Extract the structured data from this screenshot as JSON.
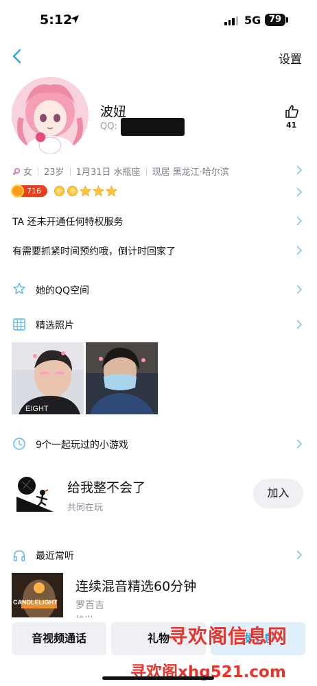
{
  "status_bar": {
    "time": "5:12",
    "network": "5G",
    "battery": "79"
  },
  "nav": {
    "settings_label": "设置"
  },
  "profile": {
    "name": "波妞",
    "qq_label": "QQ:",
    "likes": "41"
  },
  "info": {
    "gender": "女",
    "age": "23岁",
    "birthday": "1月31日 水瓶座",
    "location": "现居 黑龙江·哈尔滨",
    "level": "716"
  },
  "vip": {
    "text": "TA 还未开通任何特权服务"
  },
  "signature": {
    "text": "有需要抓紧时间预约哦，倒计时回家了"
  },
  "qzone": {
    "label": "她的QQ空间"
  },
  "photos": {
    "label": "精选照片"
  },
  "games": {
    "label": "9个一起玩过的小游戏"
  },
  "game": {
    "title": "给我整不会了",
    "subtitle": "共同在玩",
    "join_label": "加入"
  },
  "music": {
    "label": "最近常听",
    "title": "连续混音精选60分钟",
    "artist": "罗百吉",
    "subtitle": "快米",
    "album_text": "CANDLELIGHT"
  },
  "actions": {
    "call_label": "音视频通话",
    "gift_label": "礼物",
    "add_label": "发消息"
  },
  "watermark": {
    "line1": "寻欢阁信息网",
    "line2": "寻欢阁xhg521.com"
  }
}
